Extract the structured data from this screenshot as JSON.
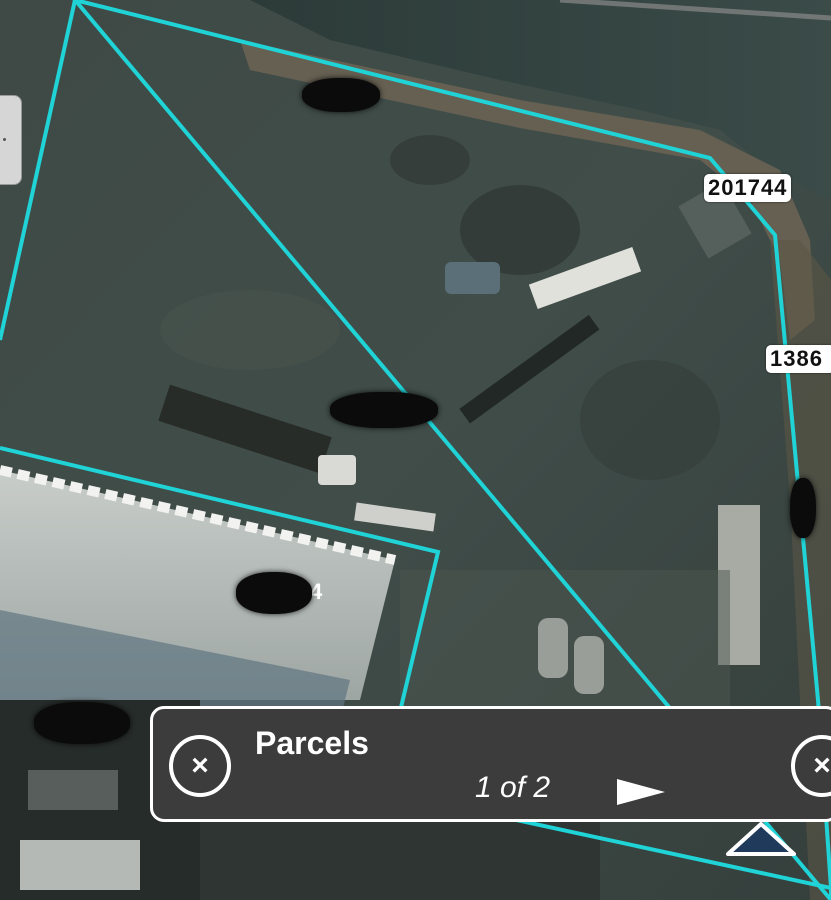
{
  "map": {
    "parcel_labels": [
      {
        "id": "top-right",
        "text": "201744"
      },
      {
        "id": "right-edge",
        "text": "1386"
      },
      {
        "id": "bottom-right",
        "text": "4"
      },
      {
        "id": "center-partial",
        "text": "4"
      }
    ],
    "colors": {
      "parcel_outline": "#1fd3d6",
      "label_bg": "#ffffff",
      "redaction": "#0b0b0b"
    }
  },
  "popup": {
    "title": "Parcels",
    "count": "1 of 2",
    "close_icon": "close-icon",
    "next_icon": "play-arrow-icon"
  },
  "controls": {
    "expand_icon": "chevron-up-icon"
  }
}
